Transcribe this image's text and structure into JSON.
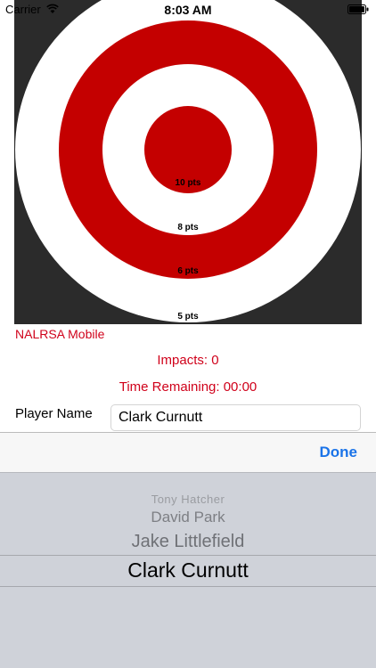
{
  "status_bar": {
    "carrier": "Carrier",
    "time": "8:03 AM"
  },
  "target": {
    "ring_labels": [
      "10 pts",
      "8 pts",
      "6 pts",
      "5 pts"
    ],
    "colors": {
      "background": "#2b2b2b",
      "red": "#c40000",
      "white": "#ffffff"
    }
  },
  "app_name": "NALRSA Mobile",
  "impacts_text": "Impacts: 0",
  "time_remaining_text": "Time Remaining: 00:00",
  "player": {
    "label": "Player Name",
    "value": "Clark Curnutt"
  },
  "toolbar": {
    "done_label": "Done"
  },
  "picker": {
    "options": [
      "Tony Hatcher",
      "David Park",
      "Jake Littlefield",
      "Clark Curnutt"
    ],
    "selected": "Clark Curnutt"
  },
  "accent_color": "#d0021b",
  "link_color": "#1a73e8"
}
